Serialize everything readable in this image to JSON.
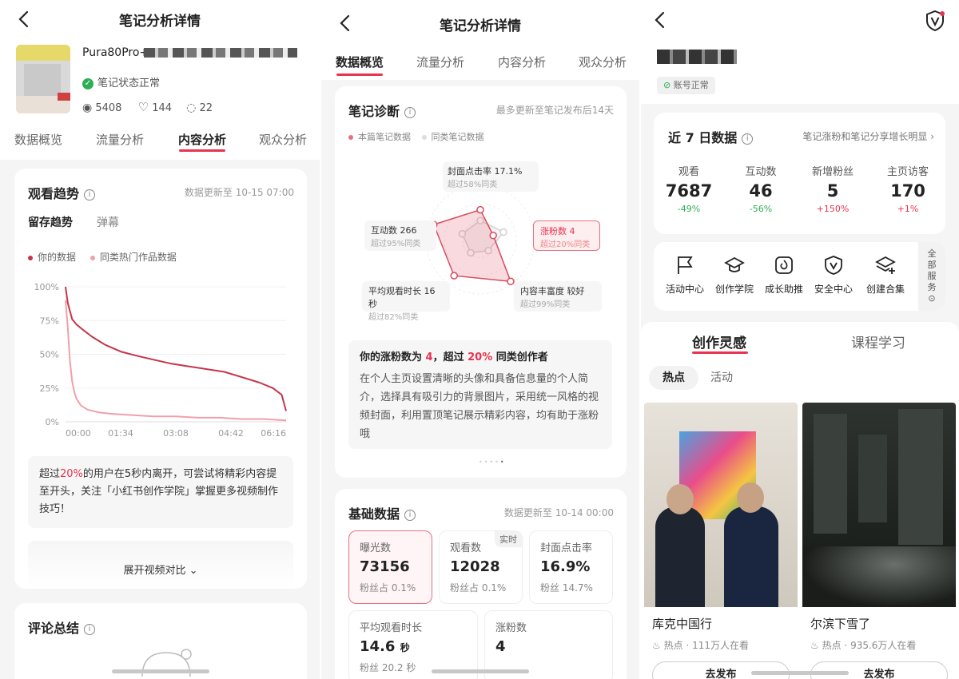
{
  "panel1": {
    "header_title": "笔记分析详情",
    "note_title": "Pura80Pro+",
    "note_status": "笔记状态正常",
    "stats": {
      "views": "5408",
      "likes": "144",
      "comments": "22"
    },
    "tabs": [
      "数据概览",
      "流量分析",
      "内容分析",
      "观众分析"
    ],
    "watch_trend": {
      "title": "观看趋势",
      "update": "数据更新至 10-15 07:00",
      "subtabs": [
        "留存趋势",
        "弹幕"
      ],
      "legend_mine": "你的数据",
      "legend_peer": "同类热门作品数据",
      "tip_prefix": "超过",
      "tip_pct": "20%",
      "tip_rest": "的用户在5秒内离开，可尝试将精彩内容提至开头，关注「小红书创作学院」掌握更多视频制作技巧！",
      "expand": "展开视频对比"
    },
    "comment_title": "评论总结"
  },
  "chart_data": {
    "type": "line",
    "title": "",
    "xlabel": "",
    "ylabel": "",
    "x_ticks": [
      "00:00",
      "01:34",
      "03:08",
      "04:42",
      "06:16"
    ],
    "y_ticks": [
      "100%",
      "75%",
      "50%",
      "25%",
      "0%"
    ],
    "ylim": [
      0,
      100
    ],
    "xlim": [
      0,
      100
    ],
    "grid": true,
    "legend": "top-left",
    "series": [
      {
        "name": "你的数据",
        "color": "#c8334a",
        "x": [
          0,
          1,
          2,
          3,
          5,
          8,
          12,
          18,
          25,
          32,
          40,
          48,
          56,
          64,
          72,
          80,
          88,
          94,
          98,
          100
        ],
        "y": [
          100,
          88,
          82,
          76,
          72,
          68,
          63,
          57,
          52,
          49,
          46,
          43,
          41,
          39,
          37,
          33,
          29,
          25,
          20,
          8
        ]
      },
      {
        "name": "同类热门作品数据",
        "color": "#f0a0aa",
        "x": [
          0,
          1,
          2,
          3,
          4,
          5,
          7,
          10,
          15,
          20,
          30,
          40,
          50,
          60,
          70,
          80,
          90,
          100
        ],
        "y": [
          90,
          70,
          45,
          30,
          22,
          17,
          12,
          9,
          7,
          6,
          5,
          4,
          4,
          3,
          3,
          2,
          2,
          1
        ]
      }
    ]
  },
  "panel2": {
    "header_title": "笔记分析详情",
    "tabs": [
      "数据概览",
      "流量分析",
      "内容分析",
      "观众分析"
    ],
    "diag": {
      "title": "笔记诊断",
      "update": "最多更新至笔记发布后14天",
      "legend_mine": "本篇笔记数据",
      "legend_peer": "同类笔记数据",
      "labels": [
        {
          "t": "封面点击率 17.1%",
          "s": "超过58%同类"
        },
        {
          "t": "涨粉数 4",
          "s": "超过20%同类"
        },
        {
          "t": "内容丰富度 较好",
          "s": "超过99%同类"
        },
        {
          "t": "平均观看时长 16秒",
          "s": "超过82%同类"
        },
        {
          "t": "互动数 266",
          "s": "超过95%同类"
        }
      ],
      "radar_mine": [
        0.55,
        0.25,
        0.95,
        0.82,
        0.9
      ],
      "radar_peer": [
        0.35,
        0.45,
        0.25,
        0.3,
        0.35
      ],
      "summary_a": "你的涨粉数为",
      "summary_b": "4",
      "summary_c": "，超过",
      "summary_d": "20%",
      "summary_e": "同类创作者",
      "summary_body": "在个人主页设置清晰的头像和具备信息量的个人简介，选择具有吸引力的背景图片，采用统一风格的视频封面，利用置顶笔记展示精彩内容，均有助于涨粉哦"
    },
    "basic": {
      "title": "基础数据",
      "update": "数据更新至 10-14 00:00",
      "realtime": "实时",
      "items": [
        {
          "l": "曝光数",
          "v": "73156",
          "s": "粉丝占 0.1%"
        },
        {
          "l": "观看数",
          "v": "12028",
          "s": "粉丝占 0.1%"
        },
        {
          "l": "封面点击率",
          "v": "16.9%",
          "s": "粉丝 14.7%"
        },
        {
          "l": "平均观看时长",
          "v": "14.6",
          "unit": "秒",
          "s": "粉丝 20.2 秒"
        },
        {
          "l": "涨粉数",
          "v": "4",
          "s": ""
        }
      ]
    }
  },
  "panel3": {
    "account_status": "账号正常",
    "week": {
      "title": "近 7 日数据",
      "link": "笔记涨粉和笔记分享增长明显",
      "items": [
        {
          "l": "观看",
          "v": "7687",
          "c": "-49%",
          "up": false
        },
        {
          "l": "互动数",
          "v": "46",
          "c": "-56%",
          "up": false
        },
        {
          "l": "新增粉丝",
          "v": "5",
          "c": "+150%",
          "up": true
        },
        {
          "l": "主页访客",
          "v": "170",
          "c": "+1%",
          "up": true
        }
      ]
    },
    "services": [
      "活动中心",
      "创作学院",
      "成长助推",
      "安全中心",
      "创建合集"
    ],
    "all_services": "全部服务",
    "inspire_tabs": [
      "创作灵感",
      "课程学习"
    ],
    "chips": [
      "热点",
      "活动"
    ],
    "feed": [
      {
        "title": "库克中国行",
        "tag": "热点",
        "meta": "111万人在看",
        "btn": "去发布"
      },
      {
        "title": "尔滨下雪了",
        "tag": "热点",
        "meta": "935.6万人在看",
        "btn": "去发布"
      }
    ]
  }
}
